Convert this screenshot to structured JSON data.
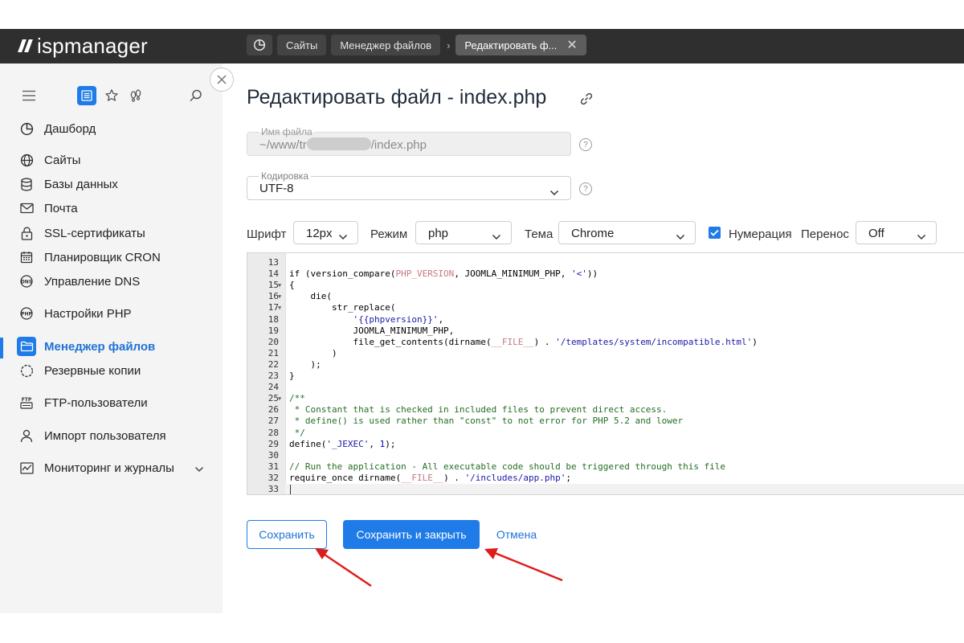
{
  "app": {
    "logo": "ispmanager"
  },
  "breadcrumbs": {
    "items": [
      "Сайты",
      "Менеджер файлов"
    ],
    "active": "Редактировать ф..."
  },
  "sidebar": {
    "items": [
      {
        "label": "Дашборд",
        "icon": "dashboard-icon"
      },
      {
        "label": "Сайты",
        "icon": "globe-icon"
      },
      {
        "label": "Базы данных",
        "icon": "database-icon"
      },
      {
        "label": "Почта",
        "icon": "mail-icon"
      },
      {
        "label": "SSL-сертификаты",
        "icon": "lock-icon"
      },
      {
        "label": "Планировщик CRON",
        "icon": "calendar-icon"
      },
      {
        "label": "Управление DNS",
        "icon": "dns-icon"
      },
      {
        "label": "Настройки PHP",
        "icon": "php-icon"
      },
      {
        "label": "Менеджер файлов",
        "icon": "folder-icon"
      },
      {
        "label": "Резервные копии",
        "icon": "backup-icon"
      },
      {
        "label": "FTP-пользователи",
        "icon": "ftp-icon"
      },
      {
        "label": "Импорт пользователя",
        "icon": "user-icon"
      },
      {
        "label": "Мониторинг и журналы",
        "icon": "monitoring-icon"
      }
    ],
    "active_item": "Менеджер файлов"
  },
  "page": {
    "title": "Редактировать файл - index.php"
  },
  "form": {
    "filename": {
      "label": "Имя файла",
      "value_prefix": "~/www/tr",
      "value_suffix": "/index.php"
    },
    "encoding": {
      "label": "Кодировка",
      "value": "UTF-8"
    }
  },
  "toolbar": {
    "font_label": "Шрифт",
    "font_value": "12px",
    "mode_label": "Режим",
    "mode_value": "php",
    "theme_label": "Тема",
    "theme_value": "Chrome",
    "numbering_label": "Нумерация",
    "numbering_checked": true,
    "wrap_label": "Перенос",
    "wrap_value": "Off"
  },
  "editor": {
    "lines": [
      {
        "n": "13",
        "text": "",
        "fold": false
      },
      {
        "n": "14",
        "text": "if (version_compare(PHP_VERSION, JOOMLA_MINIMUM_PHP, '<'))",
        "fold": false
      },
      {
        "n": "15",
        "text": "{",
        "fold": true
      },
      {
        "n": "16",
        "text": "    die(",
        "fold": true
      },
      {
        "n": "17",
        "text": "        str_replace(",
        "fold": true
      },
      {
        "n": "18",
        "text": "            '{{phpversion}}',",
        "fold": false
      },
      {
        "n": "19",
        "text": "            JOOMLA_MINIMUM_PHP,",
        "fold": false
      },
      {
        "n": "20",
        "text": "            file_get_contents(dirname(__FILE__) . '/templates/system/incompatible.html')",
        "fold": false
      },
      {
        "n": "21",
        "text": "        )",
        "fold": false
      },
      {
        "n": "22",
        "text": "    );",
        "fold": false
      },
      {
        "n": "23",
        "text": "}",
        "fold": false
      },
      {
        "n": "24",
        "text": "",
        "fold": false
      },
      {
        "n": "25",
        "text": "/**",
        "fold": true
      },
      {
        "n": "26",
        "text": " * Constant that is checked in included files to prevent direct access.",
        "fold": false
      },
      {
        "n": "27",
        "text": " * define() is used rather than \"const\" to not error for PHP 5.2 and lower",
        "fold": false
      },
      {
        "n": "28",
        "text": " */",
        "fold": false
      },
      {
        "n": "29",
        "text": "define('_JEXEC', 1);",
        "fold": false
      },
      {
        "n": "30",
        "text": "",
        "fold": false
      },
      {
        "n": "31",
        "text": "// Run the application - All executable code should be triggered through this file",
        "fold": false
      },
      {
        "n": "32",
        "text": "require_once dirname(__FILE__) . '/includes/app.php';",
        "fold": false
      },
      {
        "n": "33",
        "text": "",
        "fold": false
      }
    ]
  },
  "actions": {
    "save": "Сохранить",
    "save_close": "Сохранить и закрыть",
    "cancel": "Отмена"
  },
  "colors": {
    "accent": "#1f7be8",
    "topbar": "#2f2f2f",
    "sidebar": "#f4f4f4",
    "annotation_arrow": "#e01b1b"
  }
}
